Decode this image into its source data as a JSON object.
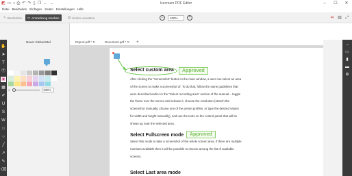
{
  "window": {
    "title": "Icecream PDF Editor",
    "controls": [
      "–",
      "☐",
      "✕"
    ]
  },
  "menu": [
    "Datei",
    "Bearbeiten",
    "Einfügen",
    "Seiten",
    "Einstellungen",
    "Hilfe"
  ],
  "toolbar": {
    "edit_label": "Bearbeiten",
    "annotate_label": "Anmerkung machen",
    "manage_label": "Seiten verwalten",
    "zoom_value": "100%"
  },
  "left_panel": {
    "tab_label": "Neuer Klebezettel",
    "swatch_colors": [
      "#ffffff",
      "#f5f5f5",
      "#e6e6e6",
      "#cccccc",
      "#b3b3b3",
      "#999999",
      "#808080",
      "#333333",
      "#d9eedd",
      "#fff3b0",
      "#fde0c2",
      "#f9cfd7",
      "#e4d4f2",
      "#d0e3f7",
      "#c6ecef",
      "#ffffff",
      "#a8d89d",
      "#ffe680",
      "#fbc08e",
      "#f3a4b6",
      "#c9a9e6",
      "#a6c8f0",
      "#93dbe2",
      "#f2f2f2"
    ],
    "opacity_value": "100%"
  },
  "doc_tabs": [
    {
      "label": "Report.pdf *"
    },
    {
      "label": "Document.pdf *"
    }
  ],
  "document": {
    "section1": {
      "heading": "Select custom area",
      "badge": "Approved",
      "lines": [
        "After clicking the \"Screenshot\" button in the main window, a user can select an area",
        "of the screen to make a screenshot of. To do that, follow the same guidelines that",
        "were described earlier in the \"Select recording area\" section of the manual – toggle",
        "the frame over the screen and release it, choose the resolution (stretch the",
        "screenshot manually, choose one of the preset profiles, or type the desired values",
        "for width and height manually), and use the tools on the control panel that will be",
        "shown up near the selected area."
      ]
    },
    "section2": {
      "heading": "Select Fullscreen mode",
      "badge": "Approved",
      "lines": [
        "Select this mode to take a screenshot of the whole screen area. If there are multiple",
        "monitors available then it will be possible to choose among the list of available",
        "screens."
      ]
    },
    "section3": {
      "heading": "Select Last area mode"
    }
  },
  "colors": {
    "accent_pink": "#d24a8c",
    "approved_green": "#7cc25a",
    "note_blue": "#5fa8d9"
  }
}
